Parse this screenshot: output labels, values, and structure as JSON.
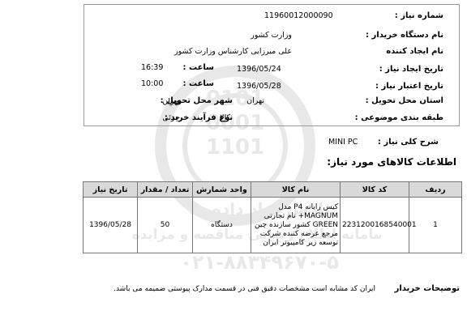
{
  "header": {
    "need_number_label": "شماره نیاز :",
    "need_number": "11960012000090",
    "buyer_org_label": "نام دستگاه خریدار :",
    "buyer_org": "وزارت کشور",
    "creator_label": "نام ایجاد کننده",
    "creator": "علی میرزایی کارشناس وزارت کشور",
    "created_date_label": "تاریخ ایجاد نیاز :",
    "created_date": "1396/05/24",
    "created_time_label": "ساعت :",
    "created_time": "16:39",
    "validity_date_label": "تاریخ اعتبار نیاز :",
    "validity_date": "1396/05/28",
    "validity_time_label": "ساعت :",
    "validity_time": "10:00",
    "delivery_province_label": "استان محل تحویل :",
    "delivery_province": "تهران",
    "delivery_city_label": "شهر محل تحویل :",
    "delivery_city": "تهران",
    "category_label": "طبقه بندی موضوعی :",
    "category": "کالا",
    "purchase_type_label": "نوع فرآیند خرید :",
    "purchase_type": "جزئی"
  },
  "summary": {
    "label": "شرح کلی نیاز :",
    "value": "MINI PC"
  },
  "section_title": "اطلاعات کالاهای مورد نیاز:",
  "table": {
    "headers": [
      "ردیف",
      "کد کالا",
      "نام کالا",
      "واحد شمارش",
      "تعداد / مقدار",
      "تاریخ نیاز"
    ],
    "rows": [
      {
        "row_no": "1",
        "code": "2231200168540001",
        "name": "کیس رایانه P4 مدل MAGNUM+ نام تجارتی GREEN کشور سازنده چین مرجع عرضه کننده شرکت توسعه زیر کامپیوتر ایران",
        "unit": "دستگاه",
        "qty": "50",
        "date": "1396/05/28"
      }
    ]
  },
  "notes": {
    "label": "توضیحات خریدار",
    "text": "ایران کد مشابه است مشخصات دقیق فنی در قسمت مدارک پیوستی ضمیمه می باشد."
  },
  "watermark": {
    "line1": "پارس نماد داده ها",
    "line2": "سامانه اطلاع رسانی مناقصه و مزایده",
    "phone": "۰۲۱-۸۸۳۴۹۶۷۰-۵"
  }
}
